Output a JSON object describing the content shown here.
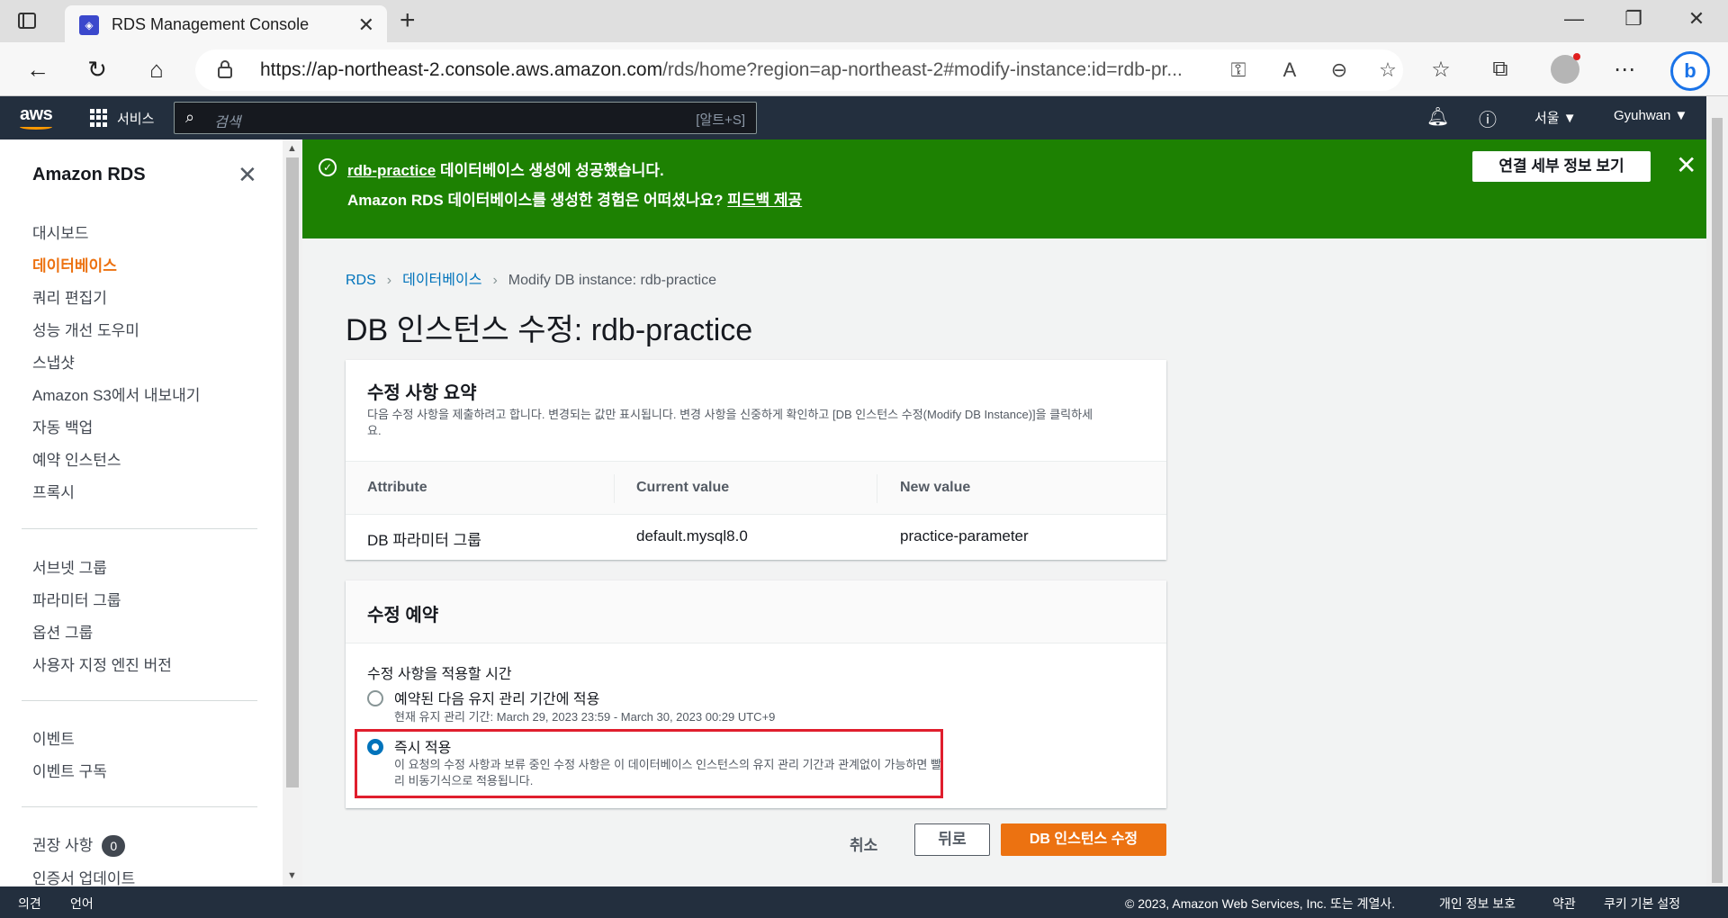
{
  "browser": {
    "tab_title": "RDS Management Console",
    "url_host": "https://ap-northeast-2.console.aws.amazon.com",
    "url_path": "/rds/home?region=ap-northeast-2#modify-instance:id=rdb-pr..."
  },
  "aws_nav": {
    "logo": "aws",
    "services": "서비스",
    "search_placeholder": "검색",
    "search_shortcut": "[알트+S]",
    "region": "서울 ▼",
    "user": "Gyuhwan ▼"
  },
  "sidebar": {
    "title": "Amazon RDS",
    "group1": [
      "대시보드",
      "데이터베이스",
      "쿼리 편집기",
      "성능 개선 도우미",
      "스냅샷",
      "Amazon S3에서 내보내기",
      "자동 백업",
      "예약 인스턴스",
      "프록시"
    ],
    "group2": [
      "서브넷 그룹",
      "파라미터 그룹",
      "옵션 그룹",
      "사용자 지정 엔진 버전"
    ],
    "group3": [
      "이벤트",
      "이벤트 구독"
    ],
    "group4_label": "권장 사항",
    "group4_badge": "0",
    "group4_next": "인증서 업데이트"
  },
  "flash": {
    "db_link": "rdb-practice",
    "line1_rest": " 데이터베이스 생성에 성공했습니다.",
    "line2": "Amazon RDS 데이터베이스를 생성한 경험은 어떠셨나요? ",
    "feedback_link": "피드백 제공",
    "button": "연결 세부 정보 보기"
  },
  "breadcrumb": {
    "root": "RDS",
    "parent": "데이터베이스",
    "current": "Modify DB instance: rdb-practice"
  },
  "page_title": "DB 인스턴스 수정: rdb-practice",
  "summary": {
    "title": "수정 사항 요약",
    "description": "다음 수정 사항을 제출하려고 합니다. 변경되는 값만 표시됩니다. 변경 사항을 신중하게 확인하고 [DB 인스턴스 수정(Modify DB Instance)]을 클릭하세요.",
    "columns": [
      "Attribute",
      "Current value",
      "New value"
    ],
    "row": [
      "DB 파라미터 그룹",
      "default.mysql8.0",
      "practice-parameter"
    ]
  },
  "schedule": {
    "title": "수정 예약",
    "label": "수정 사항을 적용할 시간",
    "option1_label": "예약된 다음 유지 관리 기간에 적용",
    "option1_desc": "현재 유지 관리 기간: March 29, 2023 23:59 - March 30, 2023 00:29 UTC+9",
    "option2_label": "즉시 적용",
    "option2_desc": "이 요청의 수정 사항과 보류 중인 수정 사항은 이 데이터베이스 인스턴스의 유지 관리 기간과 관계없이 가능하면 빨리 비동기식으로 적용됩니다.",
    "selected": "option2"
  },
  "actions": {
    "cancel": "취소",
    "back": "뒤로",
    "submit": "DB 인스턴스 수정"
  },
  "footer": {
    "feedback": "의견",
    "language": "언어",
    "copyright": "© 2023, Amazon Web Services, Inc. 또는 계열사.",
    "privacy": "개인 정보 보호",
    "terms": "약관",
    "cookies": "쿠키 기본 설정"
  },
  "colors": {
    "aws_nav": "#232f3e",
    "success": "#1d8102",
    "primary": "#ec7211",
    "link": "#0073bb",
    "highlight": "#e01e2d"
  }
}
